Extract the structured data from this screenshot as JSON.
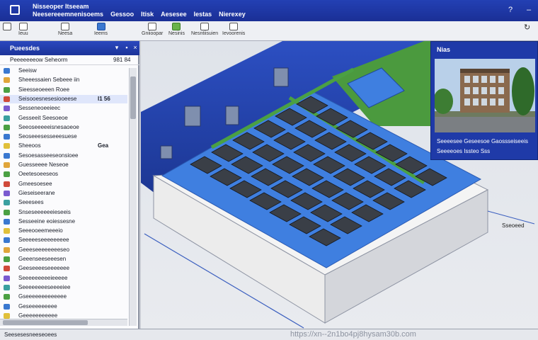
{
  "titlebar": {
    "title": "Nisseoper Itseeam",
    "menus": [
      "Neesereeemnenisoems",
      "Gessoo",
      "Itisk",
      "Aesesee",
      "Iestas",
      "Nierexey"
    ]
  },
  "toolbar": {
    "tools": [
      {
        "label": "",
        "icon": "move-icon"
      },
      {
        "label": "Ieuu",
        "icon": "view-icon"
      },
      {
        "label": "Neesa",
        "icon": "layers-icon"
      },
      {
        "label": "Ieems",
        "icon": "select-icon"
      },
      {
        "label": "Gniioopar",
        "icon": "object-icon"
      },
      {
        "label": "Nesinis",
        "icon": "plant-icon"
      },
      {
        "label": "Nesntiisuien",
        "icon": "measure-icon"
      },
      {
        "label": "Ievoorenis",
        "icon": "tool-icon"
      }
    ]
  },
  "left_panel": {
    "header": "Pueesdes",
    "sub_title": "Peeeeeeeow Seheorm",
    "sub_value": "981 84",
    "rows": [
      {
        "label": "Seeisw",
        "value": ""
      },
      {
        "label": "Sheeessaien Sebeee iin",
        "value": ""
      },
      {
        "label": "Sieesseoeeen Roee",
        "value": ""
      },
      {
        "label": "Seisooesnesesiooeese",
        "value": "I1 56"
      },
      {
        "label": "Sesseneoeeieec",
        "value": ""
      },
      {
        "label": "Gesseeit Seesoeoe",
        "value": ""
      },
      {
        "label": "Seeoseeeeeisnesaoeoe",
        "value": ""
      },
      {
        "label": "Seoseeesesseeesuese",
        "value": ""
      },
      {
        "label": "Sheeoos",
        "value": "Gea"
      },
      {
        "label": "Sesoesasseeseonsioee",
        "value": ""
      },
      {
        "label": "Guesseeee Neseoe",
        "value": ""
      },
      {
        "label": "Oeetesoeeseos",
        "value": ""
      },
      {
        "label": "Gmeesoesee",
        "value": ""
      },
      {
        "label": "Gieseiseerane",
        "value": ""
      },
      {
        "label": "Seeesees",
        "value": ""
      },
      {
        "label": "Snseseeeeeeieseeis",
        "value": ""
      },
      {
        "label": "Sesseeine eoiessesne",
        "value": ""
      },
      {
        "label": "Seeeooeemeeeio",
        "value": ""
      },
      {
        "label": "Seeeeeseeeeeeeee",
        "value": ""
      },
      {
        "label": "Geeeseeeeeeeeseo",
        "value": ""
      },
      {
        "label": "Geeenseeseeesen",
        "value": ""
      },
      {
        "label": "Geeseeeeseeeeeee",
        "value": ""
      },
      {
        "label": "Seeeeeeeeeieeeee",
        "value": ""
      },
      {
        "label": "Seeeeeeeeseeeeiee",
        "value": ""
      },
      {
        "label": "Gseeeeeeeeeeeee",
        "value": ""
      },
      {
        "label": "Geseeeeeeeee",
        "value": ""
      },
      {
        "label": "Geeeeeeeeeee",
        "value": ""
      }
    ]
  },
  "photo_panel": {
    "title": "Nias",
    "caption1": "Seeeesee Geseesoe Gaossseiseeis",
    "caption2": "Seeeeoes Issteo Sss"
  },
  "viewport": {
    "scale_label": "Sseoeed"
  },
  "statusbar": {
    "status": "Seesesesneeseoees",
    "url": "https://xn--2n1bo4pj8hysam30b.com"
  },
  "colors": {
    "title_blue": "#1f3aa8",
    "panel_blue": "#1f3aa8",
    "module_dark": "#3a3f47",
    "module_blue": "#3f7fe0",
    "grass": "#4b9a3e",
    "slab": "#eeeeee"
  }
}
